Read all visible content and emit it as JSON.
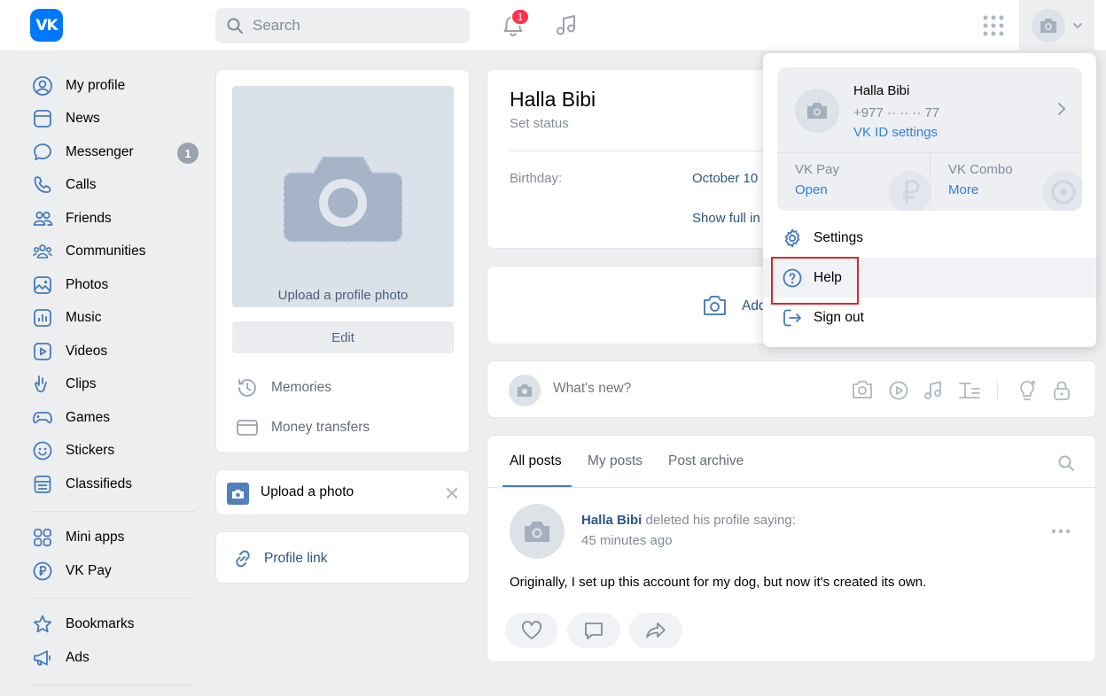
{
  "topbar": {
    "logo": "VK",
    "search_placeholder": "Search",
    "notifications_count": "1"
  },
  "sidebar": {
    "items": [
      {
        "label": "My profile",
        "icon": "user-circle-icon"
      },
      {
        "label": "News",
        "icon": "newspaper-icon"
      },
      {
        "label": "Messenger",
        "icon": "message-icon",
        "badge": "1"
      },
      {
        "label": "Calls",
        "icon": "phone-icon"
      },
      {
        "label": "Friends",
        "icon": "friends-icon"
      },
      {
        "label": "Communities",
        "icon": "communities-icon"
      },
      {
        "label": "Photos",
        "icon": "photos-icon"
      },
      {
        "label": "Music",
        "icon": "music-icon"
      },
      {
        "label": "Videos",
        "icon": "videos-icon"
      },
      {
        "label": "Clips",
        "icon": "clips-icon"
      },
      {
        "label": "Games",
        "icon": "gamepad-icon"
      },
      {
        "label": "Stickers",
        "icon": "smile-icon"
      },
      {
        "label": "Classifieds",
        "icon": "classifieds-icon"
      }
    ],
    "items2": [
      {
        "label": "Mini apps",
        "icon": "mini-apps-icon"
      },
      {
        "label": "VK Pay",
        "icon": "ruble-icon"
      }
    ],
    "items3": [
      {
        "label": "Bookmarks",
        "icon": "star-icon"
      },
      {
        "label": "Ads",
        "icon": "megaphone-icon"
      }
    ]
  },
  "profile_card": {
    "upload_label": "Upload a profile photo",
    "edit_label": "Edit",
    "memories": "Memories",
    "money_transfers": "Money transfers"
  },
  "upload_photo_card": {
    "label": "Upload a photo"
  },
  "profile_link_card": {
    "label": "Profile link"
  },
  "info_card": {
    "name": "Halla Bibi",
    "status": "Set status",
    "birthday_label": "Birthday:",
    "birthday_value": "October 10",
    "show_full": "Show full in"
  },
  "add_photos_card": {
    "label": "Add"
  },
  "composer": {
    "placeholder": "What's new?"
  },
  "posts": {
    "tabs": [
      "All posts",
      "My posts",
      "Post archive"
    ],
    "post": {
      "author": "Halla Bibi",
      "action": "deleted his profile saying:",
      "time": "45 minutes ago",
      "text": "Originally, I set up this account for my dog, but now it's created its own."
    }
  },
  "account_menu": {
    "name": "Halla Bibi",
    "phone": "+977 ·· ·· ·· 77",
    "vkid_link": "VK ID settings",
    "vkpay_title": "VK Pay",
    "vkpay_action": "Open",
    "combo_title": "VK Combo",
    "combo_action": "More",
    "items": [
      "Settings",
      "Help",
      "Sign out"
    ]
  },
  "colors": {
    "accent": "#2a5885",
    "link": "#2d81e0",
    "logo": "#0077ff",
    "badge": "#ff3347",
    "highlight_border": "#e0232b"
  }
}
